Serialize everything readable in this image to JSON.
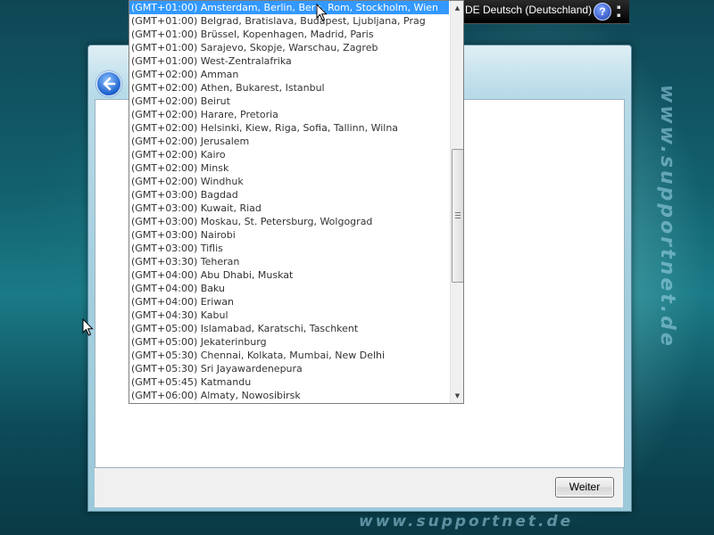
{
  "language_bar": {
    "label": "DE Deutsch (Deutschland)",
    "help_glyph": "?"
  },
  "dialog": {
    "next_button": "Weiter"
  },
  "timezones": [
    "(GMT+01:00) Amsterdam, Berlin, Bern, Rom, Stockholm, Wien",
    "(GMT+01:00) Belgrad, Bratislava, Budapest, Ljubljana, Prag",
    "(GMT+01:00) Brüssel, Kopenhagen, Madrid, Paris",
    "(GMT+01:00) Sarajevo, Skopje, Warschau, Zagreb",
    "(GMT+01:00) West-Zentralafrika",
    "(GMT+02:00) Amman",
    "(GMT+02:00) Athen, Bukarest, Istanbul",
    "(GMT+02:00) Beirut",
    "(GMT+02:00) Harare, Pretoria",
    "(GMT+02:00) Helsinki, Kiew, Riga, Sofia, Tallinn, Wilna",
    "(GMT+02:00) Jerusalem",
    "(GMT+02:00) Kairo",
    "(GMT+02:00) Minsk",
    "(GMT+02:00) Windhuk",
    "(GMT+03:00) Bagdad",
    "(GMT+03:00) Kuwait, Riad",
    "(GMT+03:00) Moskau, St. Petersburg, Wolgograd",
    "(GMT+03:00) Nairobi",
    "(GMT+03:00) Tiflis",
    "(GMT+03:30) Teheran",
    "(GMT+04:00) Abu Dhabi, Muskat",
    "(GMT+04:00) Baku",
    "(GMT+04:00) Eriwan",
    "(GMT+04:30) Kabul",
    "(GMT+05:00) Islamabad, Karatschi, Taschkent",
    "(GMT+05:00) Jekaterinburg",
    "(GMT+05:30) Chennai, Kolkata, Mumbai, New Delhi",
    "(GMT+05:30) Sri Jayawardenepura",
    "(GMT+05:45) Katmandu",
    "(GMT+06:00) Almaty, Nowosibirsk"
  ],
  "selected_index": 0,
  "icons": {
    "back": "back-arrow-icon",
    "help": "help-icon",
    "scroll_up": "scroll-up-icon",
    "scroll_down": "scroll-down-icon"
  },
  "watermarks": {
    "vertical": "www.supportnet.de",
    "horizontal": "www.supportnet.de"
  },
  "colors": {
    "selection": "#3399ff",
    "desktop": "#12606e"
  }
}
